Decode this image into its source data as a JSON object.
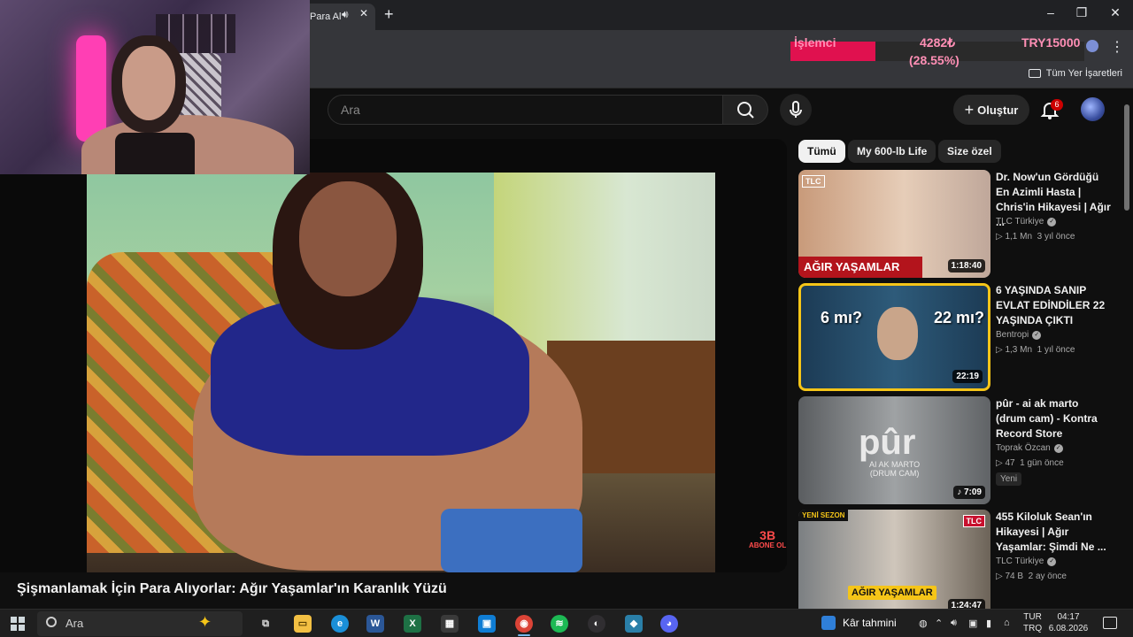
{
  "browser": {
    "tab_title": "Para Al",
    "tab_audio_icon": "speaker-icon",
    "new_tab_label": "+",
    "window_buttons": [
      "–",
      "❐",
      "✕"
    ],
    "bookmarks_folder": "Tüm Yer İşaretleri"
  },
  "stats_widget": {
    "label": "İşlemci",
    "value": "4282₺",
    "percent": "(28.55%)",
    "currency": "TRY15000"
  },
  "youtube": {
    "search_placeholder": "Ara",
    "create_label": "Oluştur",
    "notification_count": "6",
    "video_title": "Şişmanlamak İçin Para Alıyorlar: Ağır Yaşamlar'ın Karanlık Yüzü",
    "player_brand": "3B",
    "player_brand_sub": "ABONE OL",
    "chips": [
      "Tümü",
      "My 600-lb Life",
      "Size özel"
    ],
    "recommendations": [
      {
        "title": "Dr. Now'un Gördüğü En Azimli Hasta | Chris'in Hikayesi | Ağır ...",
        "channel": "TLC Türkiye",
        "views": "1,1 Mn",
        "age": "3 yıl önce",
        "duration": "1:18:40",
        "thumb_text": "AĞIR YAŞAMLAR",
        "thumb_badge": "TLC"
      },
      {
        "title": "6 YAŞINDA SANIP EVLAT EDİNDİLER 22 YAŞINDA ÇIKTI",
        "channel": "Bentropi",
        "views": "1,3 Mn",
        "age": "1 yıl önce",
        "duration": "22:19",
        "thumb_left": "6 mı?",
        "thumb_right": "22 mı?"
      },
      {
        "title": "pûr - ai ak marto (drum cam) - Kontra Record Store",
        "channel": "Toprak Özcan",
        "views": "47",
        "age": "1 gün önce",
        "badge": "Yeni",
        "duration": "♪ 7:09",
        "thumb_big": "pûr",
        "thumb_sub1": "AI AK MARTO",
        "thumb_sub2": "(DRUM CAM)"
      },
      {
        "title": "455 Kiloluk Sean'ın Hikayesi | Ağır Yaşamlar: Şimdi Ne ...",
        "channel": "TLC Türkiye",
        "views": "74 B",
        "age": "2 ay önce",
        "duration": "1:24:47",
        "thumb_text": "AĞIR YAŞAMLAR",
        "thumb_badge": "TLC",
        "thumb_corner": "YENİ SEZON"
      }
    ]
  },
  "taskbar": {
    "search_placeholder": "Ara",
    "apps": [
      "task-view",
      "file-explorer",
      "edge",
      "word",
      "excel",
      "calculator",
      "store",
      "chrome",
      "spotify",
      "obs",
      "kodi",
      "discord"
    ],
    "app_labels": [
      "⧉",
      "▭",
      "e",
      "W",
      "X",
      "▦",
      "▣",
      "◉",
      "≋",
      "◐",
      "◆",
      "◕"
    ],
    "widget_label": "Kâr tahmini",
    "lang_top": "TUR",
    "lang_bottom": "TRQ",
    "time": "04:17",
    "date": "6.08.2026"
  },
  "colors": {
    "accent_red": "#e0114f",
    "stats_text": "#ff8fb5",
    "youtube_bg": "#0f0f0f"
  }
}
